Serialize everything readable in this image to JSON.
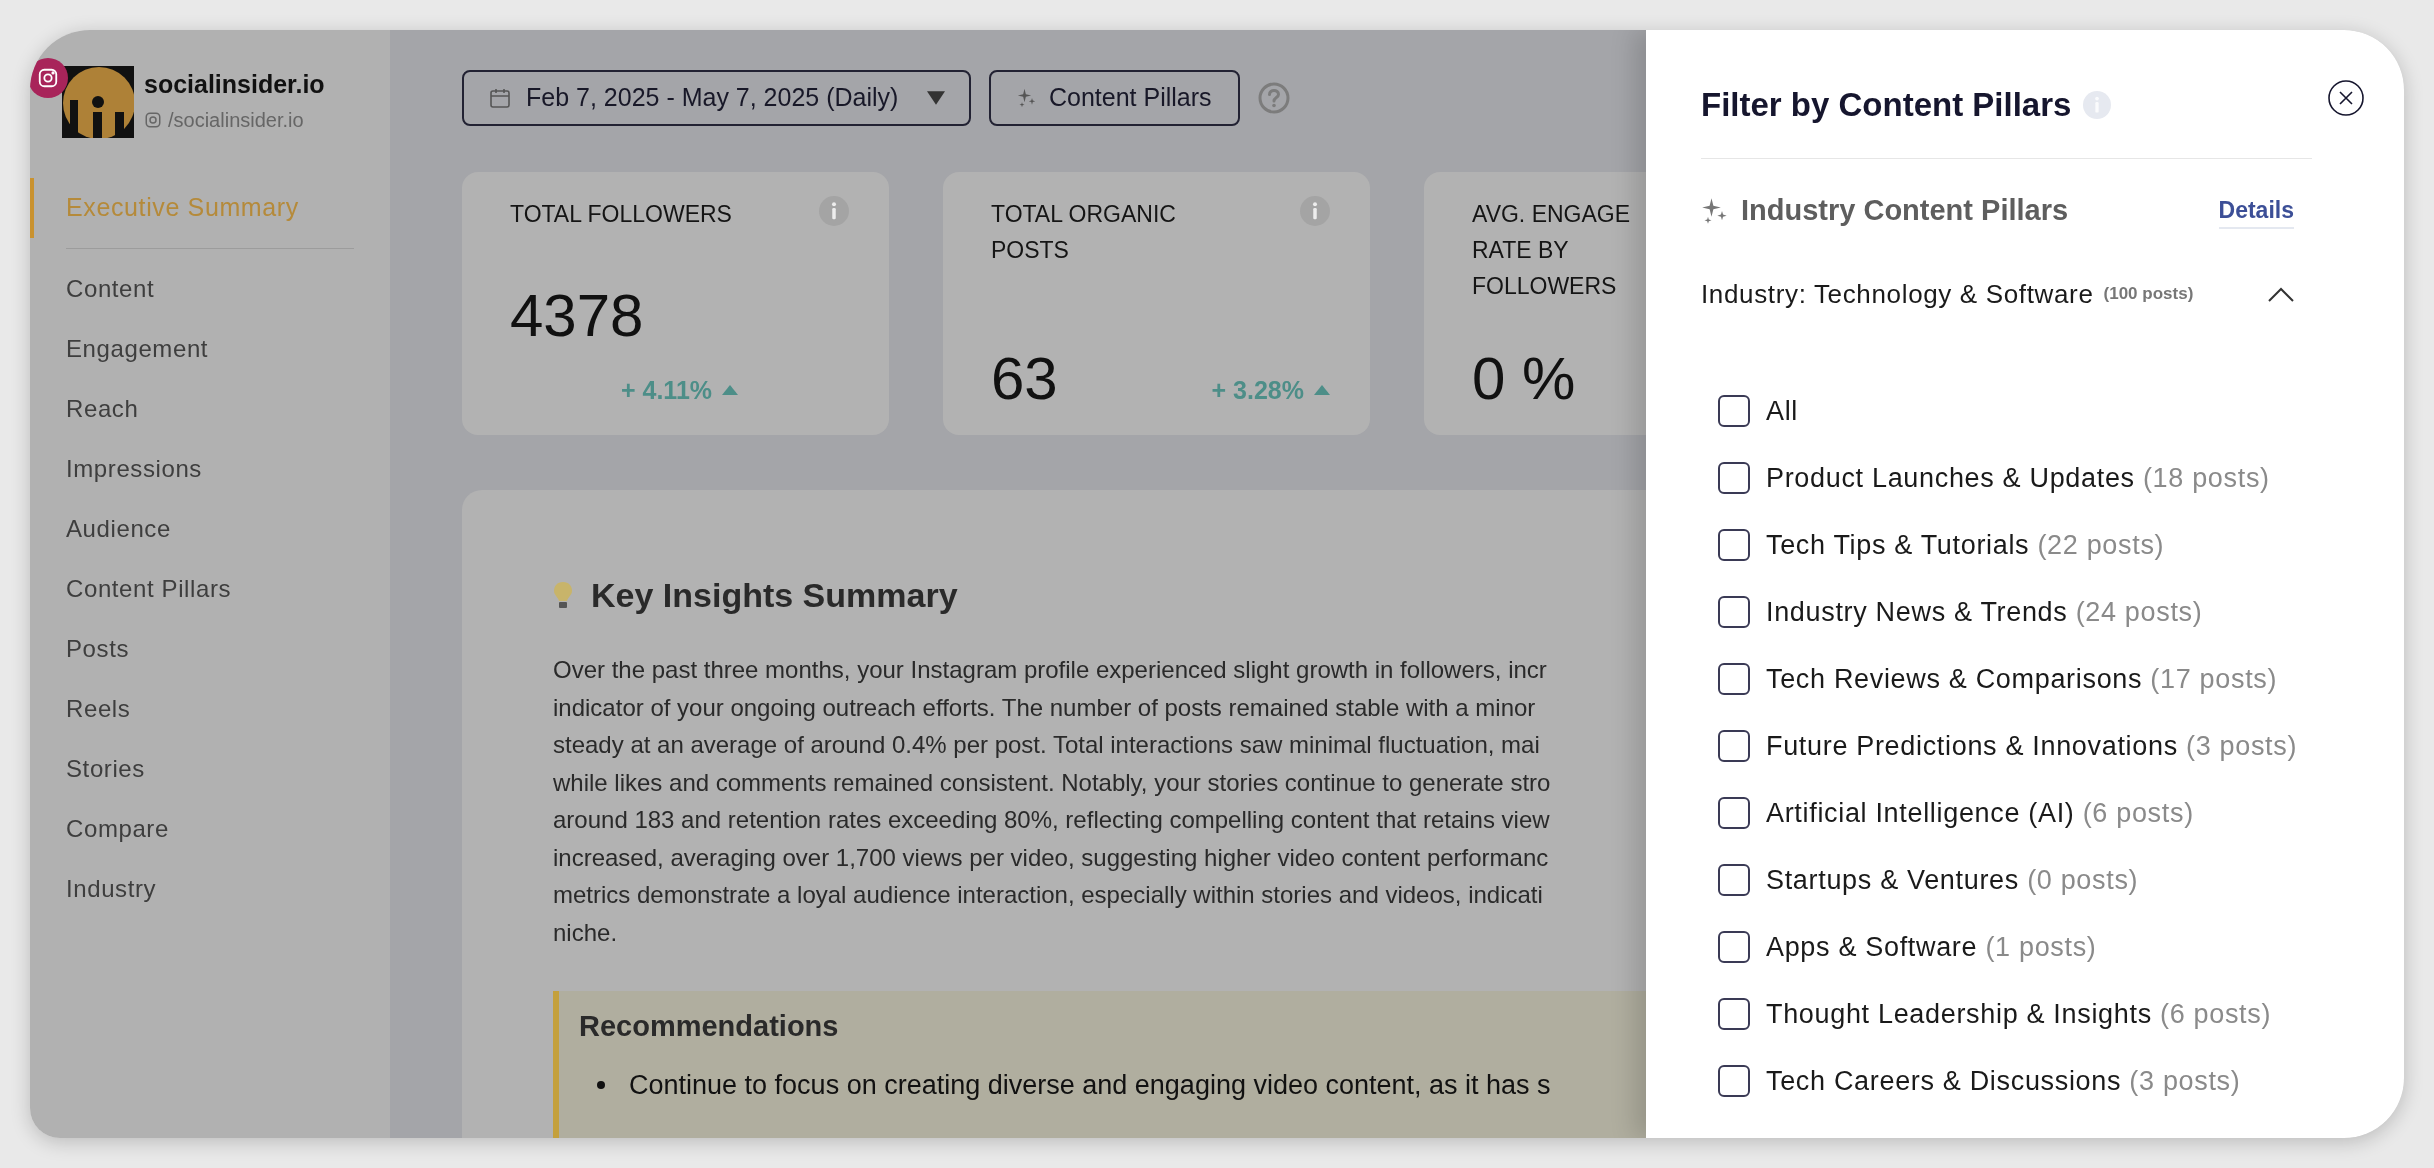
{
  "sidebar": {
    "account": {
      "name": "socialinsider.io",
      "handle": "/socialinsider.io"
    },
    "nav_items": [
      {
        "label": "Executive Summary",
        "selected": true
      },
      {
        "label": "Content",
        "selected": false
      },
      {
        "label": "Engagement",
        "selected": false
      },
      {
        "label": "Reach",
        "selected": false
      },
      {
        "label": "Impressions",
        "selected": false
      },
      {
        "label": "Audience",
        "selected": false
      },
      {
        "label": "Content Pillars",
        "selected": false
      },
      {
        "label": "Posts",
        "selected": false
      },
      {
        "label": "Reels",
        "selected": false
      },
      {
        "label": "Stories",
        "selected": false
      },
      {
        "label": "Compare",
        "selected": false
      },
      {
        "label": "Industry",
        "selected": false
      }
    ]
  },
  "toolbar": {
    "date_range": "Feb 7, 2025 - May 7, 2025 (Daily)",
    "pillars_button": "Content Pillars"
  },
  "metric_cards": [
    {
      "kind": "stacked",
      "title_lines": [
        "TOTAL FOLLOWERS"
      ],
      "value": "4378",
      "change": "+ 4.11%"
    },
    {
      "kind": "inline",
      "title_lines": [
        "TOTAL ORGANIC",
        "POSTS"
      ],
      "value": "63",
      "change": "+ 3.28%"
    },
    {
      "kind": "inline",
      "title_lines": [
        "AVG. ENGAGE",
        "RATE BY",
        "FOLLOWERS"
      ],
      "value": "0 %"
    }
  ],
  "insights": {
    "title": "Key Insights Summary",
    "paragraph_lines": [
      "Over the past three months, your Instagram profile experienced slight growth in followers, incr",
      "indicator of your ongoing outreach efforts. The number of posts remained stable with a minor",
      "steady at an average of around 0.4% per post. Total interactions saw minimal fluctuation, mai",
      "while likes and comments remained consistent. Notably, your stories continue to generate stro",
      "around 183 and retention rates exceeding 80%, reflecting compelling content that retains view",
      "increased, averaging over 1,700 views per video, suggesting higher video content performanc",
      "metrics demonstrate a loyal audience interaction, especially within stories and videos, indicati",
      "niche."
    ],
    "recommendations": {
      "title": "Recommendations",
      "items": [
        "Continue to focus on creating diverse and engaging video content, as it has s"
      ]
    }
  },
  "filter_panel": {
    "title": "Filter by Content Pillars",
    "section_title": "Industry Content Pillars",
    "details_link": "Details",
    "industry_label": "Industry: Technology & Software",
    "industry_count": "(100 posts)",
    "expanded": true,
    "options": [
      {
        "label": "All",
        "checked": false
      },
      {
        "label": "Product Launches & Updates",
        "count": "(18 posts)",
        "checked": false
      },
      {
        "label": "Tech Tips & Tutorials",
        "count": "(22 posts)",
        "checked": false
      },
      {
        "label": "Industry News & Trends",
        "count": "(24 posts)",
        "checked": false
      },
      {
        "label": "Tech Reviews & Comparisons",
        "count": "(17 posts)",
        "checked": false
      },
      {
        "label": "Future Predictions & Innovations",
        "count": "(3 posts)",
        "checked": false
      },
      {
        "label": "Artificial Intelligence (AI)",
        "count": "(6 posts)",
        "checked": false
      },
      {
        "label": "Startups & Ventures",
        "count": "(0 posts)",
        "checked": false
      },
      {
        "label": "Apps & Software",
        "count": "(1 posts)",
        "checked": false
      },
      {
        "label": "Thought Leadership & Insights",
        "count": "(6 posts)",
        "checked": false
      },
      {
        "label": "Tech Careers & Discussions",
        "count": "(3 posts)",
        "checked": false
      }
    ]
  }
}
